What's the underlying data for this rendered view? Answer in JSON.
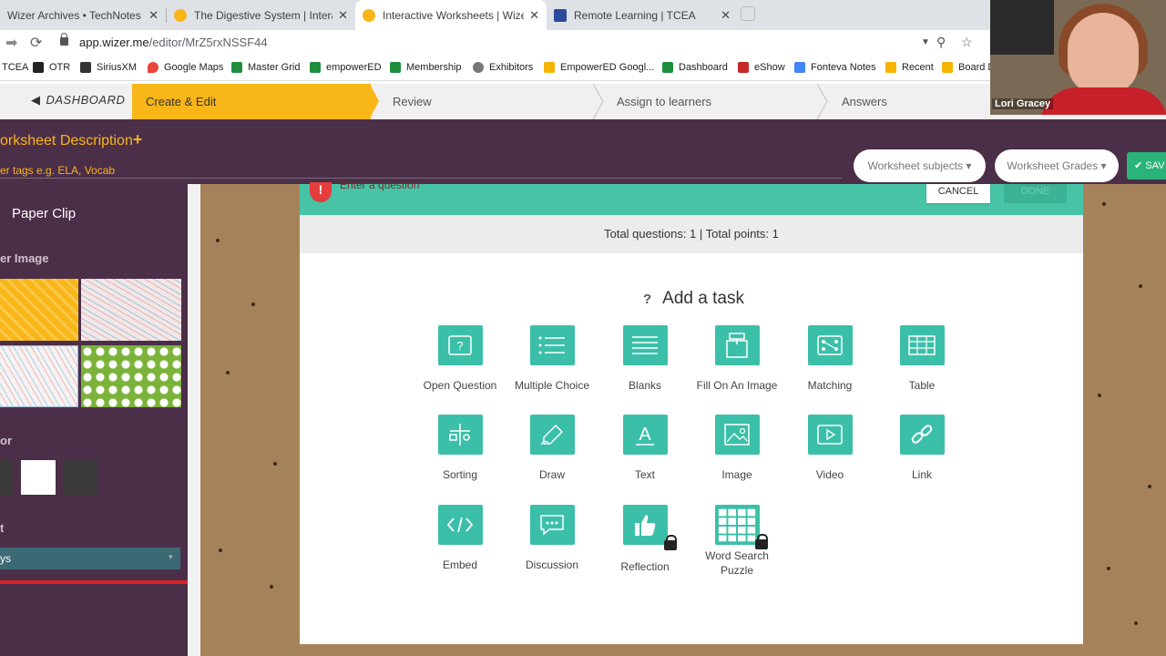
{
  "browser": {
    "tabs": [
      {
        "title": "Wizer Archives • TechNotes Blog",
        "close": "✕"
      },
      {
        "title": "The Digestive System | Interactive",
        "close": "✕"
      },
      {
        "title": "Interactive Worksheets | Wizer.me",
        "close": "✕"
      },
      {
        "title": "Remote Learning | TCEA",
        "close": "✕"
      }
    ],
    "url_host": "app.wizer.me",
    "url_path": "/editor/MrZ5rxNSSF44"
  },
  "bookmarks": [
    "TCEA",
    "OTR",
    "SiriusXM",
    "Google Maps",
    "Master Grid",
    "empowerED",
    "Membership",
    "Exhibitors",
    "EmpowerED Googl...",
    "Dashboard",
    "eShow",
    "Fonteva Notes",
    "Recent",
    "Board D"
  ],
  "steps": {
    "dashboard": "DASHBOARD",
    "items": [
      "Create & Edit",
      "Review",
      "Assign to learners",
      "Answers"
    ]
  },
  "header": {
    "description": "orksheet Description",
    "plus": "+",
    "tags_placeholder": "er tags e.g. ELA, Vocab",
    "subjects": "Worksheet subjects ▾",
    "grades": "Worksheet Grades ▾",
    "save": "✔ SAV"
  },
  "sidebar": {
    "title": "Paper Clip",
    "cover_label": "er Image",
    "color_label": "or",
    "font_label": "t",
    "font_value": "ys",
    "font_arrow": "▾"
  },
  "question": {
    "warning": "!",
    "placeholder": "Enter a question",
    "cancel": "CANCEL",
    "done": "DONE",
    "totals": "Total questions: 1 | Total points: 1"
  },
  "tasks": {
    "heading_icon": "?",
    "heading": "Add a task",
    "items": [
      {
        "label": "Open Question"
      },
      {
        "label": "Multiple Choice"
      },
      {
        "label": "Blanks"
      },
      {
        "label": "Fill On An Image"
      },
      {
        "label": "Matching"
      },
      {
        "label": "Table"
      },
      {
        "label": "Sorting"
      },
      {
        "label": "Draw"
      },
      {
        "label": "Text"
      },
      {
        "label": "Image"
      },
      {
        "label": "Video"
      },
      {
        "label": "Link"
      },
      {
        "label": "Embed"
      },
      {
        "label": "Discussion"
      },
      {
        "label": "Reflection"
      },
      {
        "label": "Word Search Puzzle"
      }
    ]
  },
  "video": {
    "name": "Lori Gracey"
  },
  "colors": {
    "accent": "#f8b618",
    "purple": "#4b2e48",
    "teal": "#3bbfa8"
  }
}
